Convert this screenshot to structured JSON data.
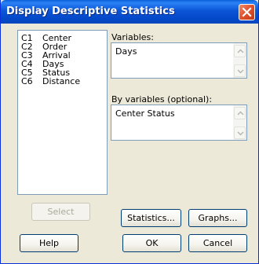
{
  "window": {
    "title": "Display Descriptive Statistics"
  },
  "columns": [
    {
      "id": "C1",
      "name": "Center"
    },
    {
      "id": "C2",
      "name": "Order"
    },
    {
      "id": "C3",
      "name": "Arrival"
    },
    {
      "id": "C4",
      "name": "Days"
    },
    {
      "id": "C5",
      "name": "Status"
    },
    {
      "id": "C6",
      "name": "Distance"
    }
  ],
  "variables": {
    "label": "Variables:",
    "value": "Days"
  },
  "by_variables": {
    "label": "By variables (optional):",
    "value": "Center Status"
  },
  "buttons": {
    "select": "Select",
    "statistics": "Statistics...",
    "graphs": "Graphs...",
    "help": "Help",
    "ok": "OK",
    "cancel": "Cancel"
  },
  "icons": {
    "close": "close-icon",
    "scroll_up": "chevron-up-icon",
    "scroll_down": "chevron-down-icon"
  }
}
